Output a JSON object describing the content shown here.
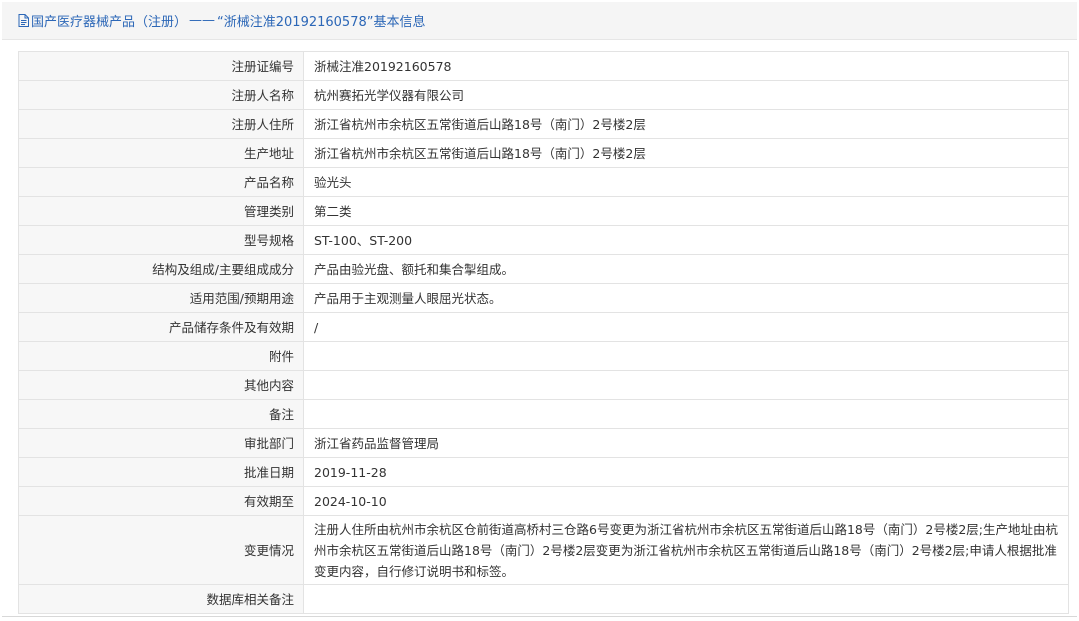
{
  "header": {
    "icon": "document-icon",
    "breadcrumb_link": "国产医疗器械产品（注册）",
    "separator": "——",
    "title_suffix": "“浙械注准20192160578”基本信息",
    "accent_color": "#2c67b7"
  },
  "rows": [
    {
      "label": "注册证编号",
      "value": "浙械注准20192160578"
    },
    {
      "label": "注册人名称",
      "value": "杭州赛拓光学仪器有限公司"
    },
    {
      "label": "注册人住所",
      "value": "浙江省杭州市余杭区五常街道后山路18号（南门）2号楼2层"
    },
    {
      "label": "生产地址",
      "value": "浙江省杭州市余杭区五常街道后山路18号（南门）2号楼2层"
    },
    {
      "label": "产品名称",
      "value": "验光头"
    },
    {
      "label": "管理类别",
      "value": "第二类"
    },
    {
      "label": "型号规格",
      "value": "ST-100、ST-200"
    },
    {
      "label": "结构及组成/主要组成成分",
      "value": "产品由验光盘、额托和集合掣组成。"
    },
    {
      "label": "适用范围/预期用途",
      "value": "产品用于主观测量人眼屈光状态。"
    },
    {
      "label": "产品储存条件及有效期",
      "value": "/"
    },
    {
      "label": "附件",
      "value": ""
    },
    {
      "label": "其他内容",
      "value": ""
    },
    {
      "label": "备注",
      "value": ""
    },
    {
      "label": "审批部门",
      "value": "浙江省药品监督管理局"
    },
    {
      "label": "批准日期",
      "value": "2019-11-28"
    },
    {
      "label": "有效期至",
      "value": "2024-10-10"
    },
    {
      "label": "变更情况",
      "value": "注册人住所由杭州市余杭区仓前街道高桥村三仓路6号变更为浙江省杭州市余杭区五常街道后山路18号（南门）2号楼2层;生产地址由杭州市余杭区五常街道后山路18号（南门）2号楼2层变更为浙江省杭州市余杭区五常街道后山路18号（南门）2号楼2层;申请人根据批准变更内容，自行修订说明书和标签。"
    },
    {
      "label": "数据库相关备注",
      "value": ""
    }
  ]
}
